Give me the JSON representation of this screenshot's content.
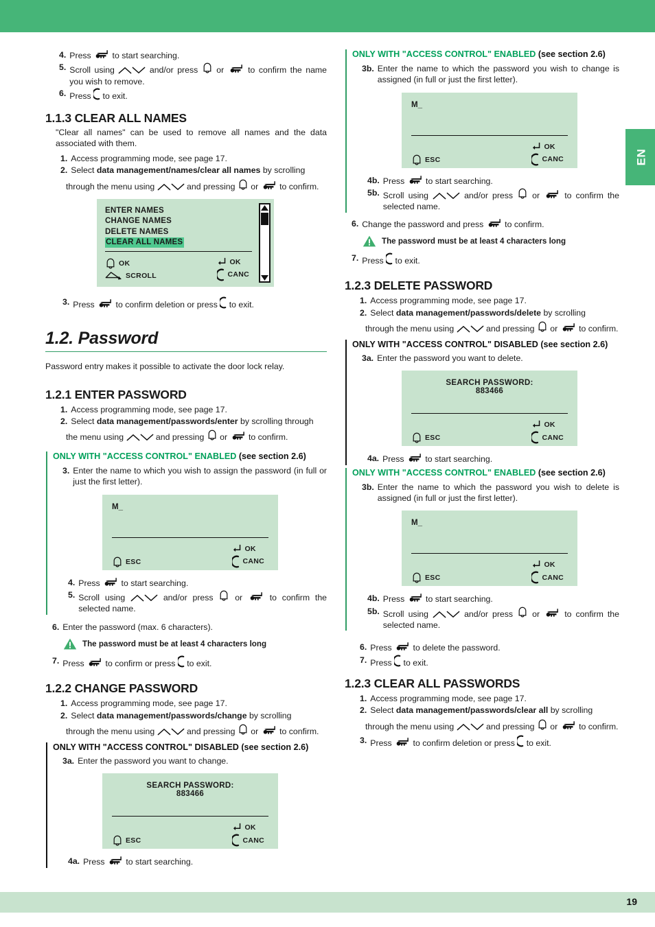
{
  "page": {
    "number": "19",
    "language_tab": "EN",
    "accent_green": "#46b578",
    "lcd_bg": "#c8e3ce",
    "highlight_green": "#4ec88e"
  },
  "left_column": {
    "top_steps": [
      {
        "num": "4.",
        "text_before": "Press ",
        "icon": "key-icon",
        "text_after": " to start searching."
      },
      {
        "num": "5.",
        "text": "Scroll using [up-arrow-icon][down-arrow-icon] and/or press [bell-icon] or [key-icon] to confirm the name you wish to remove."
      },
      {
        "num": "6.",
        "text": "Press [c-icon] to exit."
      }
    ],
    "section_113": {
      "heading": "1.1.3 CLEAR ALL NAMES",
      "intro": "\"Clear all names\" can be used to remove all names and the data associated with them.",
      "steps": [
        {
          "num": "1.",
          "text": "Access programming mode, see page 17."
        },
        {
          "num": "2.",
          "text": "Select data management/names/clear all names by scrolling through the menu using [arrows] and pressing [bell] or [key] to confirm."
        }
      ],
      "step2_plain_a": "Select ",
      "step2_bold": "data management/names/clear all names",
      "step2_plain_b": " by scrolling",
      "step2_line2_a": "through the menu using ",
      "step2_line2_b": " and pressing ",
      "step2_line2_c": " or ",
      "step2_line2_d": " to confirm.",
      "lcd": {
        "menu_items": [
          "ENTER NAMES",
          "CHANGE NAMES",
          "DELETE NAMES",
          "CLEAR ALL NAMES"
        ],
        "selected_index": 3,
        "left_buttons": [
          {
            "icon": "bell-icon",
            "label": "OK"
          },
          {
            "icon": "scroll-triangle-icon",
            "label": "SCROLL"
          }
        ],
        "right_buttons": [
          {
            "icon": "enter-arrow-icon",
            "label": "OK"
          },
          {
            "icon": "c-icon",
            "label": "CANC"
          }
        ]
      },
      "step3": {
        "num": "3.",
        "a": "Press ",
        "b": " to confirm deletion or press ",
        "c": " to exit."
      }
    },
    "section_12": {
      "heading": "1.2. Password",
      "intro": "Password entry makes it possible to activate the door lock relay."
    },
    "section_121": {
      "heading": "1.2.1 ENTER PASSWORD",
      "step1": {
        "num": "1.",
        "text": "Access programming mode, see page 17."
      },
      "step2": {
        "num": "2.",
        "a": "Select ",
        "bold": "data management/passwords/enter",
        "b": " by scrolling through"
      },
      "step2_line2_a": "the menu using ",
      "step2_line2_b": " and pressing ",
      "step2_line2_c": " or ",
      "step2_line2_d": " to confirm.",
      "callout": {
        "green": "ONLY WITH \"ACCESS CONTROL\" ENABLED",
        "black": " (see section 2.6)"
      },
      "step3": {
        "num": "3.",
        "text": "Enter the name to which you wish to assign the password (in full or just the first letter)."
      },
      "lcd": {
        "input_value": "M_",
        "left_buttons": [
          {
            "icon": "bell-icon",
            "label": "ESC"
          }
        ],
        "right_buttons": [
          {
            "icon": "enter-arrow-icon",
            "label": "OK"
          },
          {
            "icon": "c-icon",
            "label": "CANC"
          }
        ]
      },
      "step4": {
        "num": "4.",
        "a": "Press ",
        "b": " to start searching."
      },
      "step5": {
        "num": "5.",
        "a": "Scroll using ",
        "b": " and/or press ",
        "c": " or ",
        "d": " to confirm the selected name."
      },
      "step6": {
        "num": "6.",
        "text": "Enter the password (max. 6 characters)."
      },
      "warning": "The password must be at least 4 characters long",
      "step7": {
        "num": "7.",
        "a": "Press ",
        "b": " to confirm or press ",
        "c": " to exit."
      }
    },
    "section_122": {
      "heading": "1.2.2 CHANGE PASSWORD",
      "step1": {
        "num": "1.",
        "text": "Access programming mode, see page 17."
      },
      "step2": {
        "num": "2.",
        "a": "Select ",
        "bold": "data management/passwords/change",
        "b": " by  scrolling"
      },
      "step2_line2_a": "through the menu using ",
      "step2_line2_b": " and pressing ",
      "step2_line2_c": " or ",
      "step2_line2_d": " to confirm.",
      "callout_black": "ONLY WITH \"ACCESS CONTROL\" DISABLED (see section 2.6)",
      "step3a": {
        "num": "3a.",
        "text": "Enter the password you want to change."
      },
      "lcd": {
        "title": "SEARCH PASSWORD:",
        "value": "883466",
        "left_buttons": [
          {
            "icon": "bell-icon",
            "label": "ESC"
          }
        ],
        "right_buttons": [
          {
            "icon": "enter-arrow-icon",
            "label": "OK"
          },
          {
            "icon": "c-icon",
            "label": "CANC"
          }
        ]
      },
      "step4a": {
        "num": "4a.",
        "a": "Press ",
        "b": " to start searching."
      }
    }
  },
  "right_column": {
    "section_122_cont": {
      "callout": {
        "green": "ONLY WITH \"ACCESS CONTROL\" ENABLED",
        "black": " (see section 2.6)"
      },
      "step3b": {
        "num": "3b.",
        "text": "Enter the name to which the password you wish to change is assigned (in full or just the first letter)."
      },
      "lcd": {
        "input_value": "M_",
        "left_buttons": [
          {
            "icon": "bell-icon",
            "label": "ESC"
          }
        ],
        "right_buttons": [
          {
            "icon": "enter-arrow-icon",
            "label": "OK"
          },
          {
            "icon": "c-icon",
            "label": "CANC"
          }
        ]
      },
      "step4b": {
        "num": "4b.",
        "a": "Press ",
        "b": " to start searching."
      },
      "step5b": {
        "num": "5b.",
        "a": "Scroll using ",
        "b": " and/or press ",
        "c": " or ",
        "d": " to confirm the selected name."
      },
      "step6": {
        "num": "6.",
        "a": "Change the password and press ",
        "b": " to confirm."
      },
      "warning": "The password must be at least 4 characters long",
      "step7": {
        "num": "7.",
        "a": "Press ",
        "b": " to exit."
      }
    },
    "section_123_delete": {
      "heading": "1.2.3 DELETE PASSWORD",
      "step1": {
        "num": "1.",
        "text": "Access programming mode, see page 17."
      },
      "step2": {
        "num": "2.",
        "a": "Select  ",
        "bold": "data  management/passwords/delete",
        "b": "  by   scrolling"
      },
      "step2_line2_a": "through the menu using ",
      "step2_line2_b": " and pressing ",
      "step2_line2_c": " or ",
      "step2_line2_d": " to confirm.",
      "callout_black": "ONLY WITH \"ACCESS CONTROL\" DISABLED (see section 2.6)",
      "step3a": {
        "num": "3a.",
        "text": "Enter the password you want to delete."
      },
      "lcd": {
        "title": "SEARCH PASSWORD:",
        "value": "883466",
        "left_buttons": [
          {
            "icon": "bell-icon",
            "label": "ESC"
          }
        ],
        "right_buttons": [
          {
            "icon": "enter-arrow-icon",
            "label": "OK"
          },
          {
            "icon": "c-icon",
            "label": "CANC"
          }
        ]
      },
      "step4a": {
        "num": "4a.",
        "a": "Press ",
        "b": " to start searching."
      },
      "callout2": {
        "green": "ONLY WITH \"ACCESS CONTROL\" ENABLED",
        "black": " (see section 2.6)"
      },
      "step3b": {
        "num": "3b.",
        "text": "Enter the name to which the password you wish to delete is assigned (in full or just the first letter)."
      },
      "lcd2": {
        "input_value": "M_",
        "left_buttons": [
          {
            "icon": "bell-icon",
            "label": "ESC"
          }
        ],
        "right_buttons": [
          {
            "icon": "enter-arrow-icon",
            "label": "OK"
          },
          {
            "icon": "c-icon",
            "label": "CANC"
          }
        ]
      },
      "step4b": {
        "num": "4b.",
        "a": "Press ",
        "b": " to start searching."
      },
      "step5b": {
        "num": "5b.",
        "a": "Scroll using ",
        "b": " and/or press ",
        "c": " or ",
        "d": " to confirm the selected name."
      },
      "step6": {
        "num": "6.",
        "a": "Press ",
        "b": " to delete the password."
      },
      "step7": {
        "num": "7.",
        "a": "Press ",
        "b": " to exit."
      }
    },
    "section_123_clear": {
      "heading": "1.2.3 CLEAR ALL PASSWORDS",
      "step1": {
        "num": "1.",
        "text": "Access programming mode, see page 17."
      },
      "step2": {
        "num": "2.",
        "a": "Select  ",
        "bold": "data  management/passwords/clear  all",
        "b": "  by  scrolling"
      },
      "step2_line2_a": "through the menu using ",
      "step2_line2_b": " and pressing ",
      "step2_line2_c": " or ",
      "step2_line2_d": " to confirm.",
      "step3": {
        "num": "3.",
        "a": "Press ",
        "b": " to confirm deletion or press ",
        "c": " to exit."
      }
    }
  }
}
